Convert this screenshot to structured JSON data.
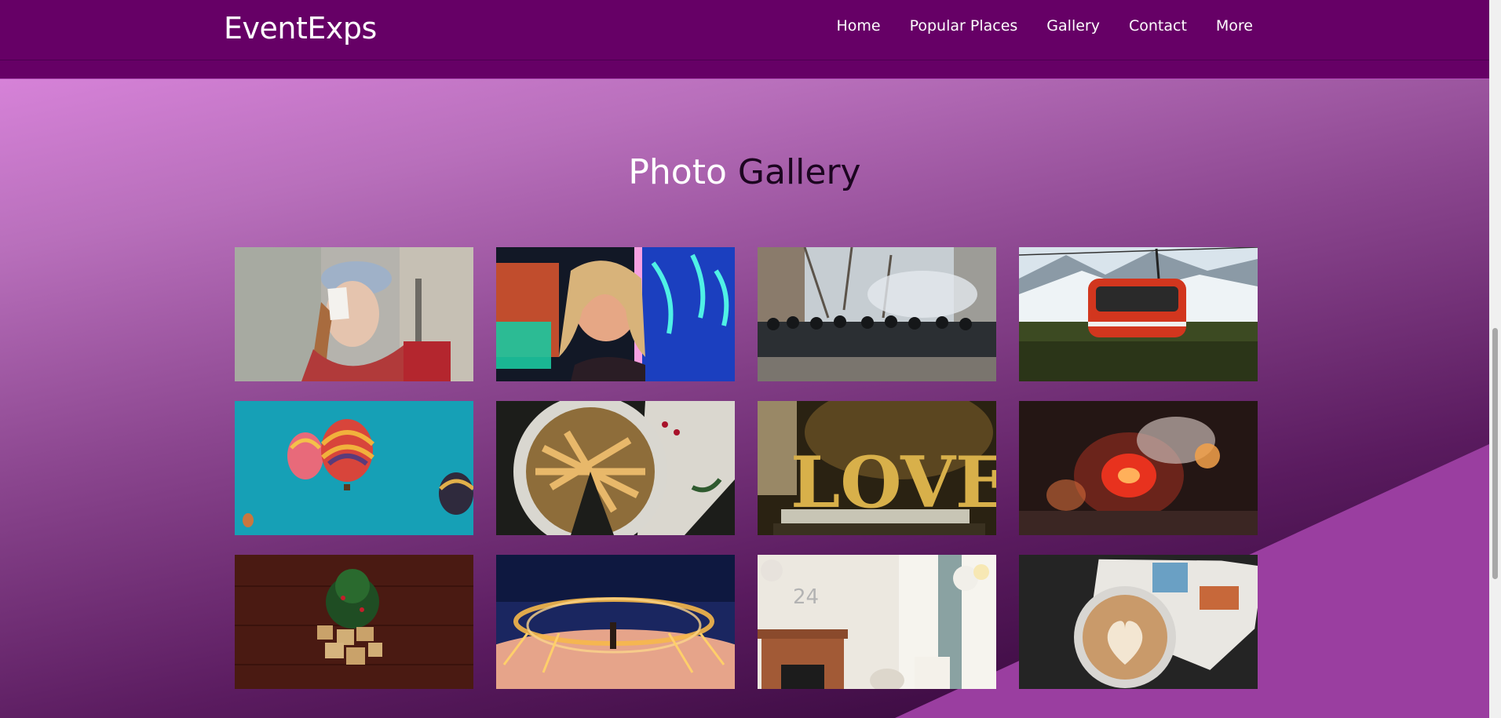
{
  "brand": "EventExps",
  "nav": [
    "Home",
    "Popular Places",
    "Gallery",
    "Contact",
    "More"
  ],
  "gallery": {
    "title_part1": "Photo",
    "title_part2": "Gallery"
  },
  "photos": [
    "woman-with-card-photo",
    "neon-smile-photo",
    "police-crowd-photo",
    "cable-car-photo",
    "hot-air-balloons-photo",
    "pie-photo",
    "love-sign-photo",
    "candle-photo",
    "christmas-tree-photo",
    "steel-wool-sparks-photo",
    "birthday-room-photo",
    "latte-photo"
  ],
  "colors": {
    "navbar": "#660066",
    "accent": "#9a3ea0"
  }
}
